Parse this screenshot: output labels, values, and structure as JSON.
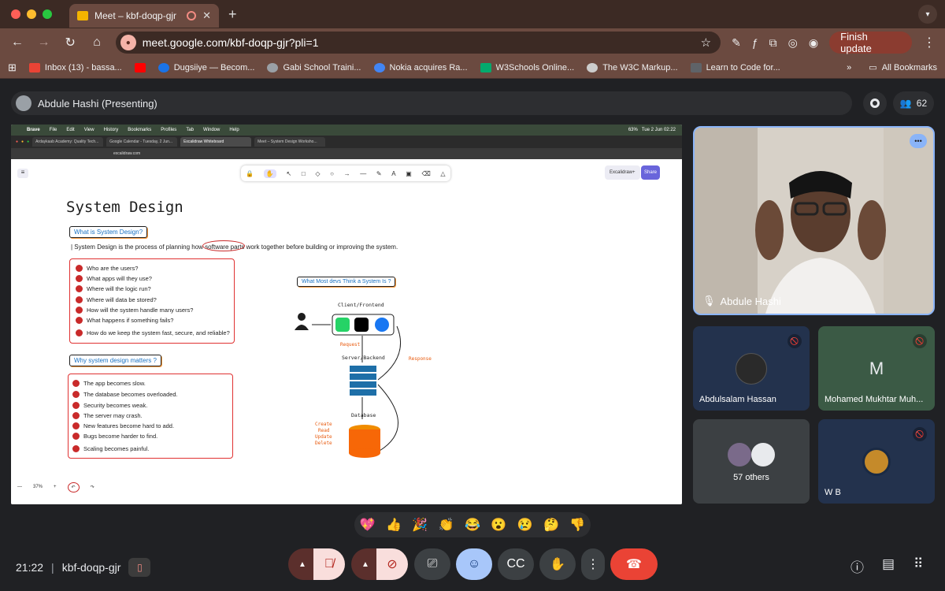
{
  "browser": {
    "tab_title": "Meet – kbf-doqp-gjr",
    "url": "meet.google.com/kbf-doqp-gjr?pli=1",
    "finish_update": "Finish update",
    "bookmarks": [
      {
        "label": "Inbox (13) - bassa...",
        "color": "#ea4335"
      },
      {
        "label": "",
        "color": "#ff0000"
      },
      {
        "label": "Dugsiiye — Becom...",
        "color": "#1a73e8"
      },
      {
        "label": "Gabi School Traini...",
        "color": "#9aa0a6"
      },
      {
        "label": "Nokia acquires Ra...",
        "color": "#4285f4"
      },
      {
        "label": "W3Schools Online...",
        "color": "#04aa6d"
      },
      {
        "label": "The W3C Markup...",
        "color": "#cccccc"
      },
      {
        "label": "Learn to Code for...",
        "color": "#5f6368"
      }
    ],
    "all_bookmarks": "All Bookmarks"
  },
  "meet": {
    "presenter_label": "Abdule Hashi (Presenting)",
    "participant_count": "62",
    "main_tile_name": "Abdule Hashi",
    "tiles": [
      {
        "name": "Abdulsalam Hassan",
        "initial": ""
      },
      {
        "name": "Mohamed Mukhtar Muh...",
        "initial": "M"
      },
      {
        "name": "57 others",
        "initial": ""
      },
      {
        "name": "W B",
        "initial": ""
      }
    ],
    "reactions": [
      "💖",
      "👍",
      "🎉",
      "👏",
      "😂",
      "😮",
      "😢",
      "🤔",
      "👎"
    ],
    "time": "21:22",
    "meeting_code": "kbf-doqp-gjr"
  },
  "shared_screen": {
    "mac_menu": [
      "Brave",
      "File",
      "Edit",
      "View",
      "History",
      "Bookmarks",
      "Profiles",
      "Tab",
      "Window",
      "Help"
    ],
    "mac_clock": "Tue 2 Jun  02:22",
    "mac_battery": "63%",
    "inner_tabs": [
      "Ardaykaab Academy: Quality Tech...",
      "Google Calendar - Tuesday, 2 Jun...",
      "Excalidraw Whiteboard",
      "Meet – System Design Worksho..."
    ],
    "inner_url": "excalidraw.com",
    "library_label": "Excalidraw+",
    "share_label": "Share",
    "zoom_level": "37%",
    "title": "System Design",
    "q1_label": "What is System Design?",
    "definition_prefix": "| System Design is the process of planning how ",
    "definition_highlight": "software parts",
    "definition_suffix": " work together before building or improving the system.",
    "questions": [
      "Who are the users?",
      "What apps will they use?",
      "Where will the logic run?",
      "Where will data be stored?",
      "How will the system handle many users?",
      "What happens if something fails?",
      "How do we keep the system fast, secure, and reliable?"
    ],
    "q2_label": "Why system design matters ?",
    "reasons": [
      "The app becomes slow.",
      "The database becomes overloaded.",
      "Security becomes weak.",
      "The server may crash.",
      "New features become hard to add.",
      "Bugs become harder to find.",
      "Scaling becomes painful."
    ],
    "diagram_label": "What Most devs Think a System Is ?",
    "client_label": "Client/Frontend",
    "server_label": "Server/Backend",
    "database_label": "Database",
    "request_label": "Request",
    "response_label": "Response",
    "crud": [
      "Create",
      "Read",
      "Update",
      "Delete"
    ]
  }
}
